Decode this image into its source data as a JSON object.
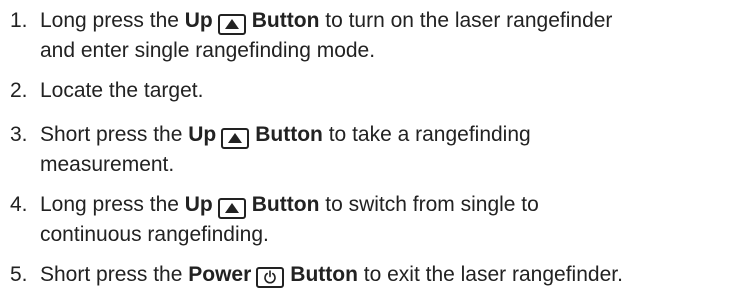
{
  "steps": [
    {
      "num": "1.",
      "pre": "Long press the ",
      "b1": "Up",
      "b2": "Button",
      "post1": " to turn on the laser rangefinder",
      "post2": "and enter single rangefinding mode.",
      "icon": "up-triangle-icon"
    },
    {
      "num": "2.",
      "text": "Locate the target."
    },
    {
      "num": "3.",
      "pre": "Short press the ",
      "b1": "Up",
      "b2": "Button",
      "post1": " to take a rangefinding",
      "post2": "measurement.",
      "icon": "up-triangle-icon"
    },
    {
      "num": "4.",
      "pre": "Long press the ",
      "b1": "Up",
      "b2": "Button",
      "post1": " to switch from single to",
      "post2": "continuous rangefinding.",
      "icon": "up-triangle-icon"
    },
    {
      "num": "5.",
      "pre": "Short press the ",
      "b1": "Power",
      "b2": "Button",
      "post1": " to exit the laser rangefinder.",
      "icon": "power-icon"
    }
  ]
}
